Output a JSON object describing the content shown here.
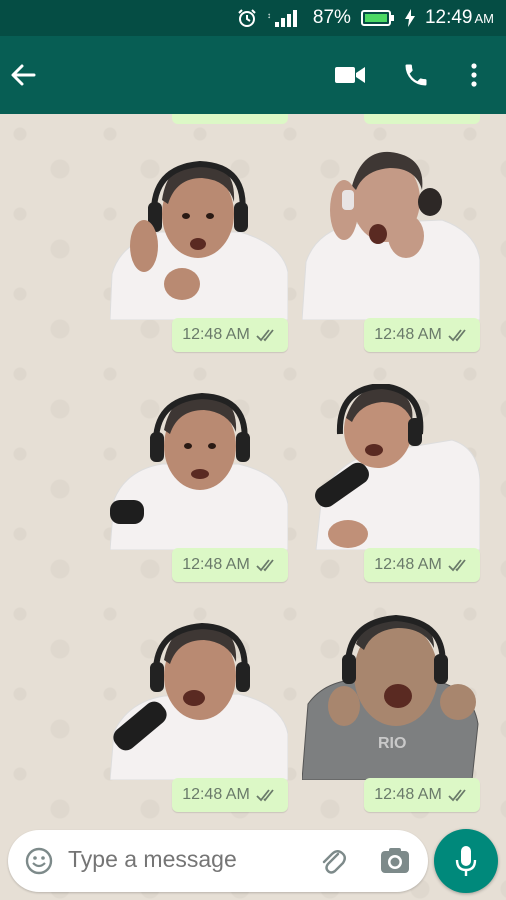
{
  "status_bar": {
    "battery_percent": "87%",
    "time": "12:49",
    "ampm": "AM",
    "icons": [
      "alarm-icon",
      "signal-icon",
      "battery-icon",
      "charging-icon"
    ]
  },
  "app_bar": {
    "icons": [
      "back-arrow-icon",
      "video-call-icon",
      "phone-call-icon",
      "overflow-menu-icon"
    ],
    "color": "#075e54"
  },
  "messages": [
    {
      "sticker": "sticker-man-headphones-hand-on-ear",
      "time": "12:48 AM",
      "status": "read"
    },
    {
      "sticker": "sticker-man-hands-on-face",
      "time": "12:48 AM",
      "status": "read"
    },
    {
      "sticker": "sticker-man-talking-microphone",
      "time": "12:48 AM",
      "status": "read"
    },
    {
      "sticker": "sticker-man-leaning-microphone",
      "time": "12:48 AM",
      "status": "read"
    },
    {
      "sticker": "sticker-man-shouting-microphone",
      "time": "12:48 AM",
      "status": "read"
    },
    {
      "sticker": "sticker-caricature-shrugging",
      "time": "12:48 AM",
      "status": "read"
    }
  ],
  "composer": {
    "placeholder": "Type a message",
    "icons": [
      "emoji-icon",
      "attach-icon",
      "camera-icon",
      "mic-icon"
    ],
    "accent": "#00897b"
  },
  "colors": {
    "bubble": "#dcf8c6",
    "status_bar": "#054d44",
    "chat_bg": "#e6dfd5"
  }
}
